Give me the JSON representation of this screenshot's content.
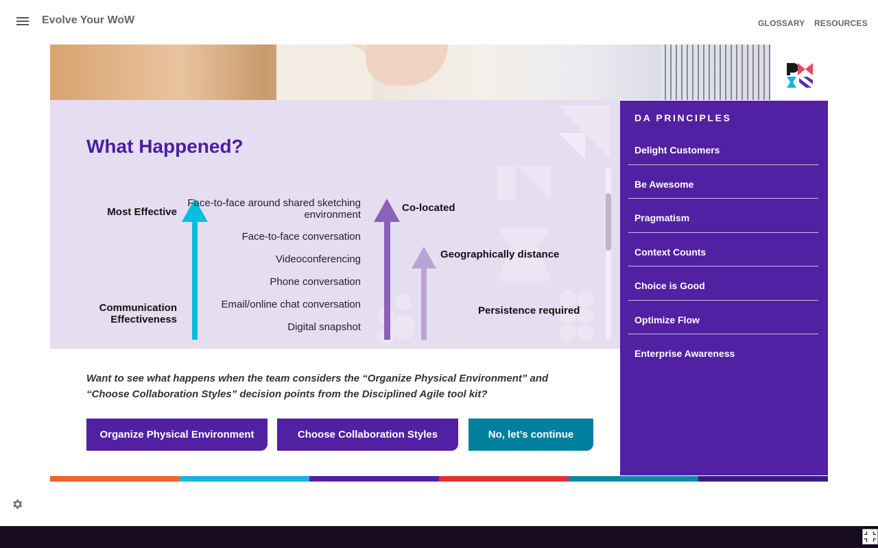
{
  "header": {
    "app_title": "Evolve Your WoW",
    "nav": [
      "GLOSSARY",
      "RESOURCES"
    ]
  },
  "main": {
    "title": "What Happened?",
    "diagram": {
      "axis_top": "Most Effective",
      "axis_bottom": "Communication Effectiveness",
      "modes": [
        "Face-to-face around shared sketching environment",
        "Face-to-face conversation",
        "Videoconferencing",
        "Phone conversation",
        "Email/online chat conversation",
        "Digital snapshot"
      ],
      "distance_labels": [
        "Co-located",
        "Geographically distance",
        "Persistence required"
      ]
    },
    "question": "Want to see what happens when the team considers the “Organize Physical Environment” and “Choose Collaboration Styles” decision points from the Disciplined Agile tool kit?",
    "buttons": [
      "Organize Physical Environment",
      "Choose Collaboration Styles",
      "No, let’s continue"
    ]
  },
  "sidebar": {
    "heading": "DA PRINCIPLES",
    "items": [
      {
        "label": "Delight Customers"
      },
      {
        "label": "Be Awesome"
      },
      {
        "label": "Pragmatism"
      },
      {
        "label": "Context Counts"
      },
      {
        "label": "Choice is Good"
      },
      {
        "label": "Optimize Flow"
      },
      {
        "label": "Enterprise Awareness"
      }
    ]
  },
  "colors": {
    "brand_purple": "#5220a3",
    "title_purple": "#4b1ea0",
    "teal": "#00809d",
    "cyan_arrow": "#05bfe0",
    "footer_stripes": [
      "#f0622e",
      "#19b4dc",
      "#5220a3",
      "#e5302a",
      "#0f88a4",
      "#3b1a85"
    ]
  },
  "icons": [
    "hamburger-menu-icon",
    "pmi-logo",
    "gear-icon",
    "exit-fullscreen-icon"
  ]
}
